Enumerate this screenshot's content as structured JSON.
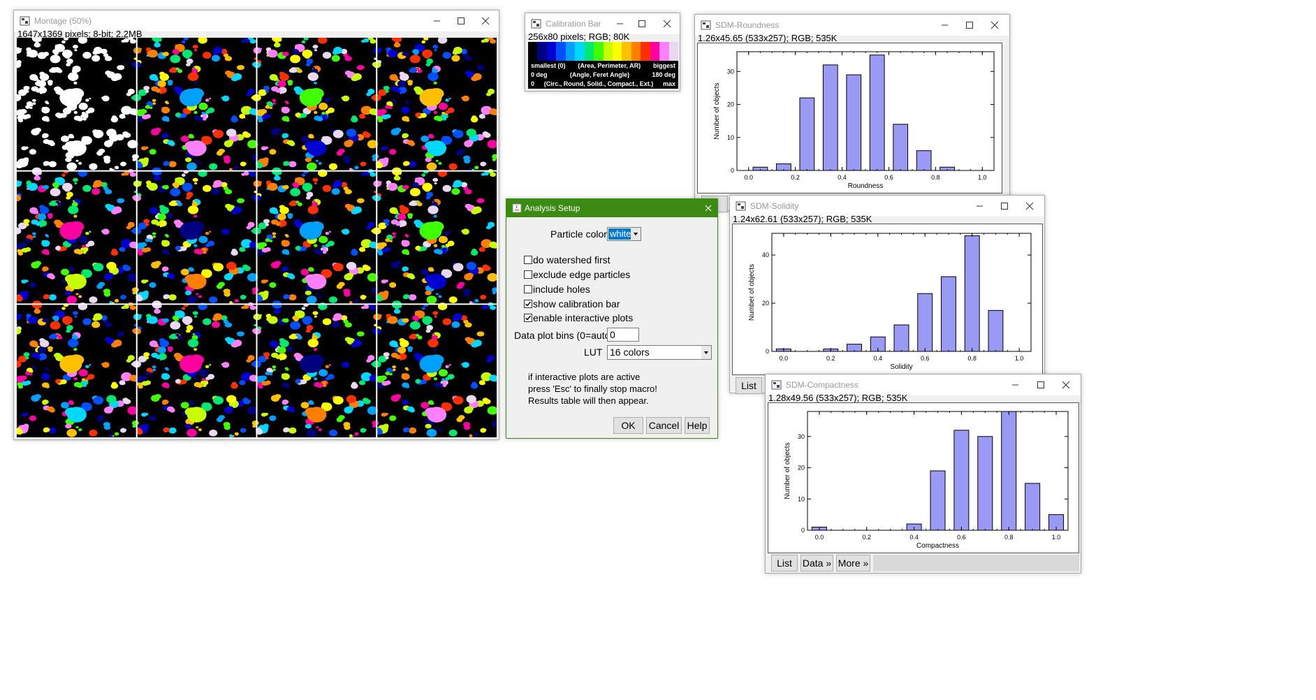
{
  "montage": {
    "title": "Montage (50%)",
    "info": "1647x1369 pixels; 8-bit; 2.2MB"
  },
  "calibration": {
    "title": "Calibration Bar",
    "info": "256x80 pixels; RGB; 80K",
    "colors": [
      "#000000",
      "#000080",
      "#0000d0",
      "#0050ff",
      "#00a0ff",
      "#00d8ff",
      "#00e870",
      "#40ff00",
      "#c8ff00",
      "#ffff00",
      "#ffc000",
      "#ff8000",
      "#ff3000",
      "#ff00a0",
      "#ff80ff",
      "#e8d8f0"
    ],
    "row1_left": "smallest (0)",
    "row1_mid": "(Area, Perimeter, AR)",
    "row1_right": "biggest",
    "row2_left": "0 deg",
    "row2_mid": "(Angle, Feret Angle)",
    "row2_right": "180 deg",
    "row3_left": "0",
    "row3_mid": "(Circ., Round, Solid., Compact., Ext.)",
    "row3_right": "max"
  },
  "setup": {
    "title": "Analysis Setup",
    "particle_color_label": "Particle color",
    "particle_color_value": "white",
    "opt_watershed": "do watershed first",
    "opt_exclude": "exclude edge particles",
    "opt_holes": "include holes",
    "opt_calib": "show calibration bar",
    "opt_plots": "enable interactive plots",
    "bins_label": "Data plot bins (0=auto)",
    "bins_value": "0",
    "lut_label": "LUT",
    "lut_value": "16 colors",
    "note1": "if interactive plots are active",
    "note2": "press 'Esc' to finally stop macro!",
    "note3": "Results table will then appear.",
    "ok": "OK",
    "cancel": "Cancel",
    "help": "Help"
  },
  "plots": [
    {
      "title": "SDM-Roundness",
      "info": "1.26x45.65   (533x257); RGB; 535K",
      "chart_data": {
        "type": "bar",
        "xlabel": "Roundness",
        "ylabel": "Number of objects",
        "x": [
          0.05,
          0.15,
          0.25,
          0.35,
          0.45,
          0.55,
          0.65,
          0.75,
          0.85,
          0.95
        ],
        "values": [
          1,
          2,
          22,
          32,
          29,
          35,
          14,
          6,
          1,
          0
        ],
        "xlim": [
          -0.05,
          1.05
        ],
        "ylim": [
          0,
          36
        ],
        "xticks": [
          "0.0",
          "0.2",
          "0.4",
          "0.6",
          "0.8",
          "1.0"
        ],
        "yticks": [
          "0",
          "10",
          "20",
          "30"
        ]
      }
    },
    {
      "title": "SDM-Solidity",
      "info": "1.24x62.61   (533x257); RGB; 535K",
      "list": "List",
      "chart_data": {
        "type": "bar",
        "xlabel": "Solidity",
        "ylabel": "Number of objects",
        "x": [
          0.0,
          0.2,
          0.3,
          0.4,
          0.5,
          0.6,
          0.7,
          0.8,
          0.9
        ],
        "values": [
          1,
          1,
          3,
          6,
          11,
          24,
          31,
          48,
          17
        ],
        "xlim": [
          -0.05,
          1.05
        ],
        "ylim": [
          0,
          49
        ],
        "xticks": [
          "0.0",
          "0.2",
          "0.4",
          "0.6",
          "0.8",
          "1.0"
        ],
        "yticks": [
          "0",
          "20",
          "40"
        ]
      }
    },
    {
      "title": "SDM-Compactness",
      "info": "1.28x49.56   (533x257); RGB; 535K",
      "list": "List",
      "data": "Data »",
      "more": "More »",
      "chart_data": {
        "type": "bar",
        "xlabel": "Compactness",
        "ylabel": "Number of objects",
        "x": [
          0.0,
          0.4,
          0.5,
          0.6,
          0.7,
          0.8,
          0.9,
          1.0
        ],
        "values": [
          1,
          2,
          19,
          32,
          30,
          38,
          15,
          5
        ],
        "xlim": [
          -0.05,
          1.05
        ],
        "ylim": [
          0,
          38
        ],
        "xticks": [
          "0.0",
          "0.2",
          "0.4",
          "0.6",
          "0.8",
          "1.0"
        ],
        "yticks": [
          "0",
          "10",
          "20",
          "30"
        ]
      }
    }
  ],
  "roundness_hidden_btn": "t"
}
